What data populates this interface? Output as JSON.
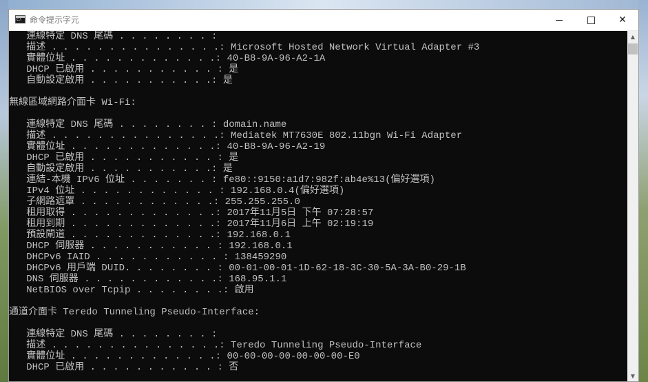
{
  "window": {
    "title": "命令提示字元",
    "controls": {
      "minimize": "minimize",
      "maximize": "maximize",
      "close": "✕"
    }
  },
  "console": {
    "lines": [
      "   連線特定 DNS 尾碼 . . . . . . . . :",
      "   描述 . . . . . . . . . . . . . . .: Microsoft Hosted Network Virtual Adapter #3",
      "   實體位址 . . . . . . . . . . . . .: 40-B8-9A-96-A2-1A",
      "   DHCP 已啟用 . . . . . . . . . . . : 是",
      "   自動設定啟用 . . . . . . . . . . .: 是",
      "",
      "無線區域網路介面卡 Wi-Fi:",
      "",
      "   連線特定 DNS 尾碼 . . . . . . . . : domain.name",
      "   描述 . . . . . . . . . . . . . . .: Mediatek MT7630E 802.11bgn Wi-Fi Adapter",
      "   實體位址 . . . . . . . . . . . . .: 40-B8-9A-96-A2-19",
      "   DHCP 已啟用 . . . . . . . . . . . : 是",
      "   自動設定啟用 . . . . . . . . . . .: 是",
      "   連結-本機 IPv6 位址 . . . . . . . : fe80::9150:a1d7:982f:ab4e%13(偏好選項)",
      "   IPv4 位址 . . . . . . . . . . . . : 192.168.0.4(偏好選項)",
      "   子網路遮罩 . . . . . . . . . . . .: 255.255.255.0",
      "   租用取得 . . . . . . . . . . . . .: 2017年11月5日 下午 07:28:57",
      "   租用到期 . . . . . . . . . . . . .: 2017年11月6日 上午 02:19:19",
      "   預設閘道 . . . . . . . . . . . . .: 192.168.0.1",
      "   DHCP 伺服器 . . . . . . . . . . . : 192.168.0.1",
      "   DHCPv6 IAID . . . . . . . . . . . : 138459290",
      "   DHCPv6 用戶端 DUID. . . . . . . . : 00-01-00-01-1D-62-18-3C-30-5A-3A-B0-29-1B",
      "   DNS 伺服器 . . . . . . . . . . . .: 168.95.1.1",
      "   NetBIOS over Tcpip . . . . . . . .: 啟用",
      "",
      "通道介面卡 Teredo Tunneling Pseudo-Interface:",
      "",
      "   連線特定 DNS 尾碼 . . . . . . . . :",
      "   描述 . . . . . . . . . . . . . . .: Teredo Tunneling Pseudo-Interface",
      "   實體位址 . . . . . . . . . . . . .: 00-00-00-00-00-00-00-E0",
      "   DHCP 已啟用 . . . . . . . . . . . : 否"
    ]
  },
  "scrollbar": {
    "up_arrow": "▲",
    "down_arrow": "▼"
  },
  "colors": {
    "console_bg": "#0c0c0c",
    "console_fg": "#c0c0c0",
    "titlebar_bg": "#ffffff"
  }
}
